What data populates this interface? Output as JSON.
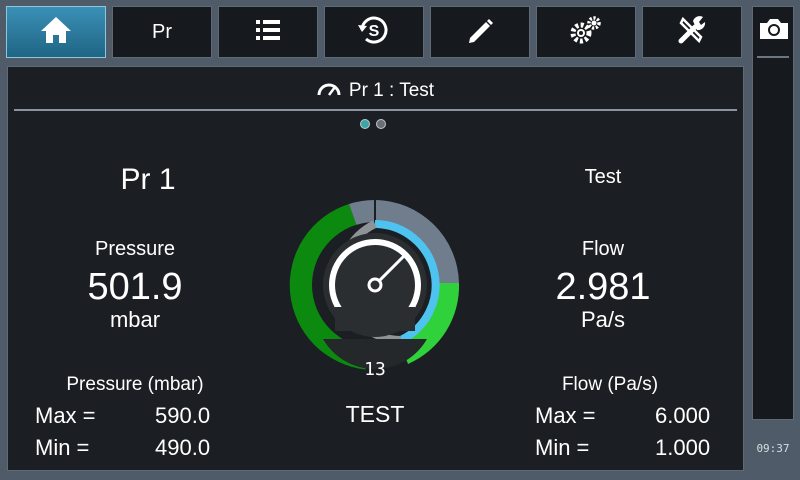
{
  "toolbar": {
    "tabs": [
      {
        "id": "home",
        "icon": "home-icon",
        "active": true
      },
      {
        "id": "program",
        "label": "Pr",
        "active": false
      },
      {
        "id": "list",
        "icon": "list-icon",
        "active": false
      },
      {
        "id": "sync",
        "icon": "sync-s-icon",
        "active": false
      },
      {
        "id": "edit",
        "icon": "pencil-icon",
        "active": false
      },
      {
        "id": "settings",
        "icon": "gears-icon",
        "active": false
      },
      {
        "id": "tools",
        "icon": "tools-icon",
        "active": false
      }
    ]
  },
  "sidebar": {
    "camera_icon": "camera-icon",
    "clock": "09:37"
  },
  "panel": {
    "title": "Pr 1 : Test",
    "title_icon": "gauge-icon",
    "page_dots": [
      true,
      false
    ],
    "program_name": "Pr 1",
    "test_name": "Test",
    "pressure": {
      "label": "Pressure",
      "value": "501.9",
      "unit": "mbar"
    },
    "flow": {
      "label": "Flow",
      "value": "2.981",
      "unit": "Pa/s"
    },
    "pressure_limits": {
      "heading": "Pressure (mbar)",
      "max_label": "Max =",
      "max": "590.0",
      "min_label": "Min =",
      "min": "490.0"
    },
    "flow_limits": {
      "heading": "Flow (Pa/s)",
      "max_label": "Max =",
      "max": "6.000",
      "min_label": "Min =",
      "min": "1.000"
    },
    "gauge": {
      "count": "13",
      "status": "TEST"
    }
  },
  "colors": {
    "active_tab": "#2e7fa5",
    "green_dark": "#0c8a10",
    "green_light": "#2fd23a",
    "slate": "#6f7d8c",
    "blue_ring": "#4fc3f0"
  }
}
